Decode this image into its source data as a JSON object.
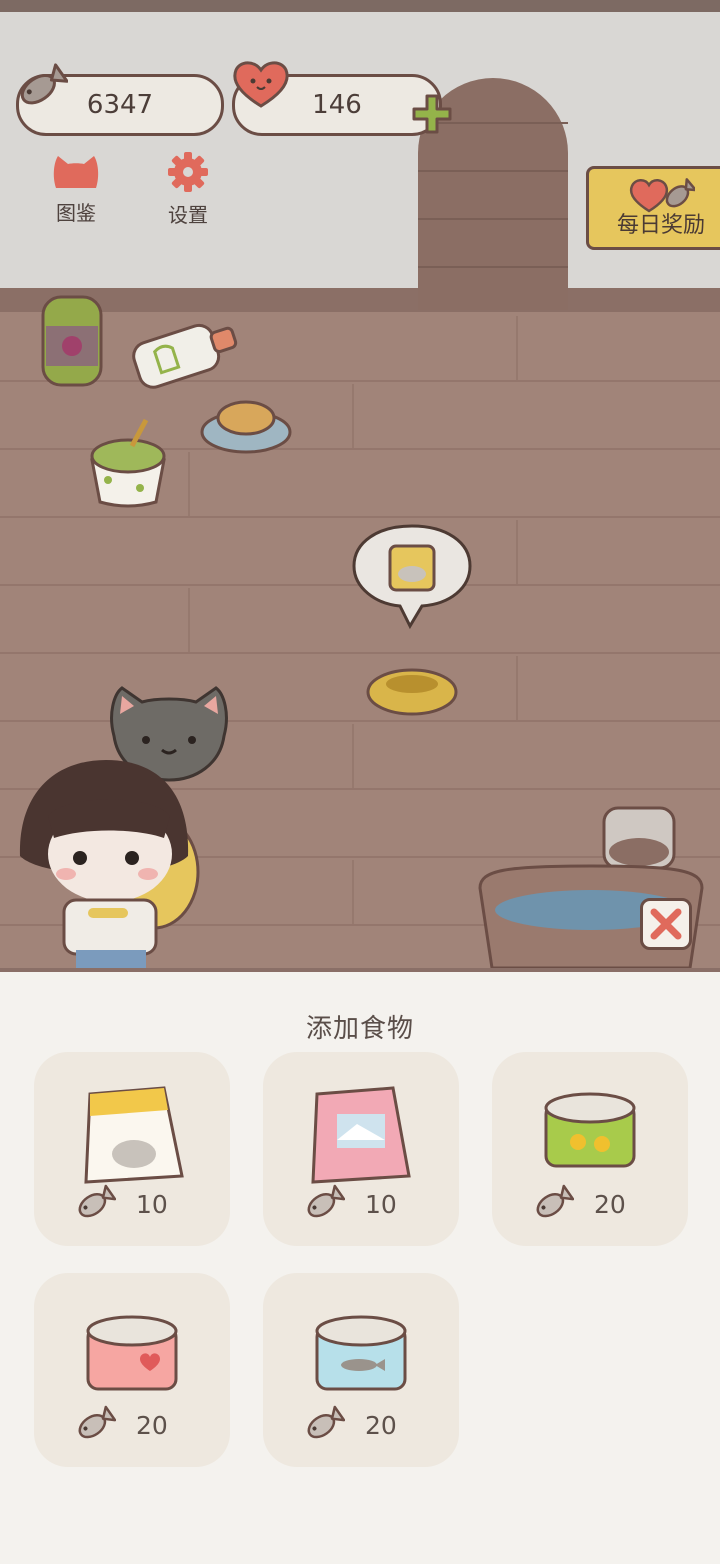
{
  "hud": {
    "fish_count": "6347",
    "heart_count": "146"
  },
  "buttons": {
    "catalog_label": "图鉴",
    "settings_label": "设置",
    "daily_reward_label": "每日奖励"
  },
  "panel": {
    "title": "添加食物",
    "items": [
      {
        "name": "yellow-food-bag",
        "price": "10"
      },
      {
        "name": "pink-food-bag",
        "price": "10"
      },
      {
        "name": "green-can",
        "price": "20"
      },
      {
        "name": "pink-can",
        "price": "20"
      },
      {
        "name": "blue-fish-can",
        "price": "20"
      }
    ]
  },
  "colors": {
    "fish_icon": "#a69a93",
    "heart_icon": "#e06a5c",
    "accent_green": "#94b34a",
    "daily_banner": "#e6c65d"
  }
}
